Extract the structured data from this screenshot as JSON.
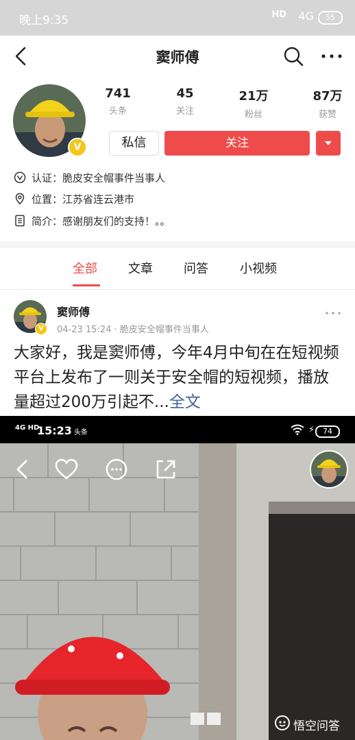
{
  "status_bar": {
    "time": "晚上9:35",
    "signal": "HD",
    "network": "4G",
    "battery": "55"
  },
  "nav": {
    "title": "窦师傅"
  },
  "profile": {
    "stats": [
      {
        "value": "741",
        "label": "头条"
      },
      {
        "value": "45",
        "label": "关注"
      },
      {
        "value": "21万",
        "label": "粉丝"
      },
      {
        "value": "87万",
        "label": "获赞"
      }
    ],
    "message_button": "私信",
    "follow_button": "关注",
    "verify_badge": "V",
    "verification": "认证：脆皮安全帽事件当事人",
    "location": "位置：江苏省连云港市",
    "bio": "简介：感谢朋友们的支持！。。"
  },
  "tabs": [
    "全部",
    "文章",
    "问答",
    "小视频"
  ],
  "post": {
    "author": "窦师傅",
    "meta": "04-23 15:24 · 脆皮安全帽事件当事人",
    "body": "大家好，我是窦师傅，今年4月中旬在在短视频平台上发布了一则关于安全帽的短视频，播放量超过200万引起不...",
    "more": "全文"
  },
  "video": {
    "time": "15:23",
    "signal": "4G HD",
    "app_tag": "头条",
    "battery": "74"
  },
  "watermark": "悟空问答",
  "colors": {
    "accent": "#f04b4b",
    "link": "#406599",
    "badge": "#f5c518"
  }
}
